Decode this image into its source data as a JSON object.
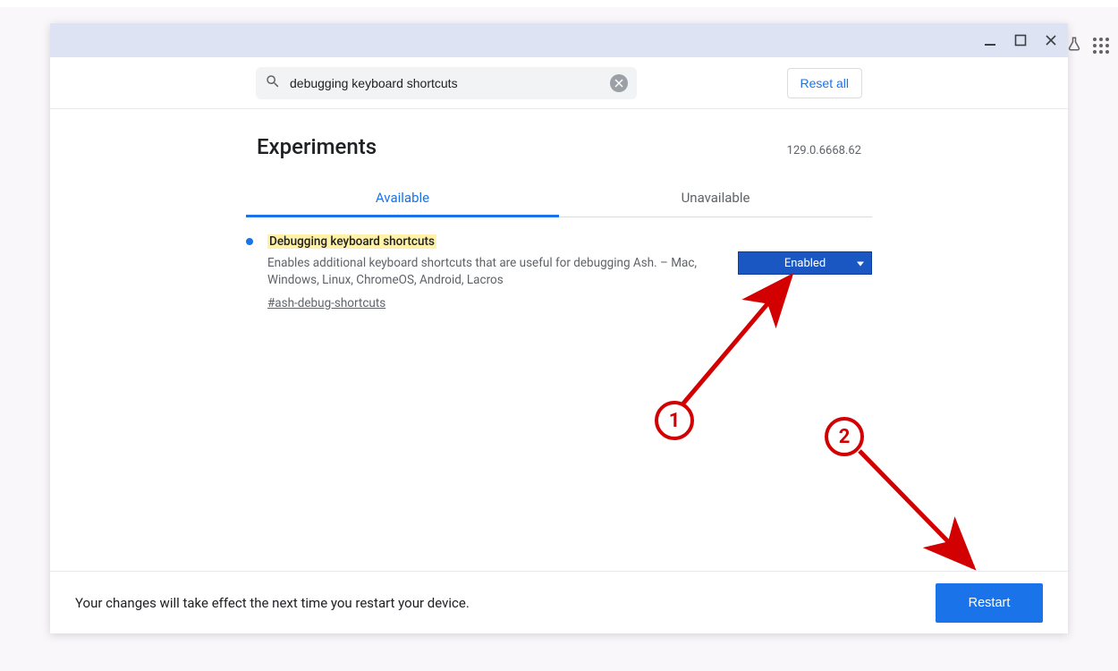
{
  "search": {
    "value": "debugging keyboard shortcuts"
  },
  "toolbar": {
    "reset_label": "Reset all"
  },
  "page": {
    "title": "Experiments",
    "version": "129.0.6668.62"
  },
  "tabs": {
    "available": "Available",
    "unavailable": "Unavailable"
  },
  "flag": {
    "title": "Debugging keyboard shortcuts",
    "description": "Enables additional keyboard shortcuts that are useful for debugging Ash. – Mac, Windows, Linux, ChromeOS, Android, Lacros",
    "hash": "#ash-debug-shortcuts",
    "dropdown_value": "Enabled"
  },
  "footer": {
    "message": "Your changes will take effect the next time you restart your device.",
    "restart_label": "Restart"
  },
  "annotations": {
    "step1": "1",
    "step2": "2"
  }
}
